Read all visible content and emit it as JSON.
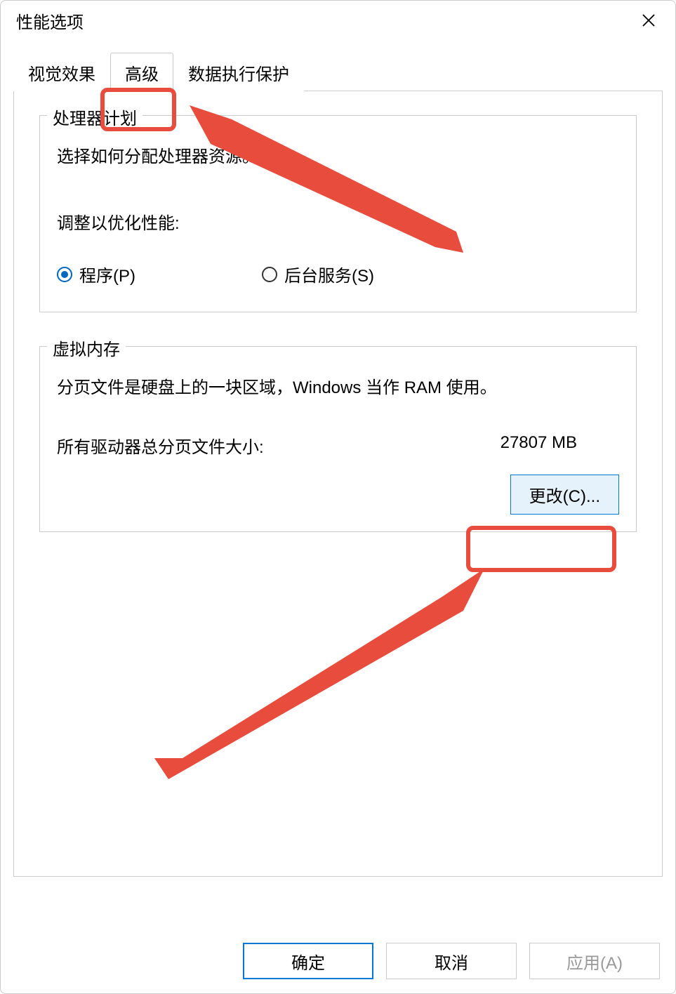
{
  "window": {
    "title": "性能选项"
  },
  "tabs": {
    "visual": "视觉效果",
    "advanced": "高级",
    "dep": "数据执行保护"
  },
  "processor": {
    "group_title": "处理器计划",
    "description": "选择如何分配处理器资源。",
    "adjust_label": "调整以优化性能:",
    "option_programs": "程序(P)",
    "option_background": "后台服务(S)"
  },
  "virtual_memory": {
    "group_title": "虚拟内存",
    "description": "分页文件是硬盘上的一块区域，Windows 当作 RAM 使用。",
    "total_label": "所有驱动器总分页文件大小:",
    "total_value": "27807 MB",
    "change_button": "更改(C)..."
  },
  "footer": {
    "ok": "确定",
    "cancel": "取消",
    "apply": "应用(A)"
  }
}
